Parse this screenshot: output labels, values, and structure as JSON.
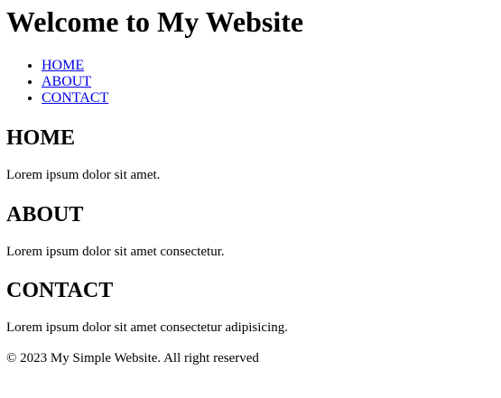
{
  "header": {
    "title": "Welcome to My Website"
  },
  "nav": {
    "items": [
      {
        "label": "HOME"
      },
      {
        "label": "ABOUT"
      },
      {
        "label": "CONTACT"
      }
    ]
  },
  "sections": {
    "home": {
      "heading": "HOME",
      "text": "Lorem ipsum dolor sit amet."
    },
    "about": {
      "heading": "ABOUT",
      "text": "Lorem ipsum dolor sit amet consectetur."
    },
    "contact": {
      "heading": "CONTACT",
      "text": "Lorem ipsum dolor sit amet consectetur adipisicing."
    }
  },
  "footer": {
    "text": "© 2023 My Simple Website. All right reserved"
  },
  "colors": {
    "link": "#0000ee",
    "text": "#000000",
    "background": "#ffffff"
  }
}
